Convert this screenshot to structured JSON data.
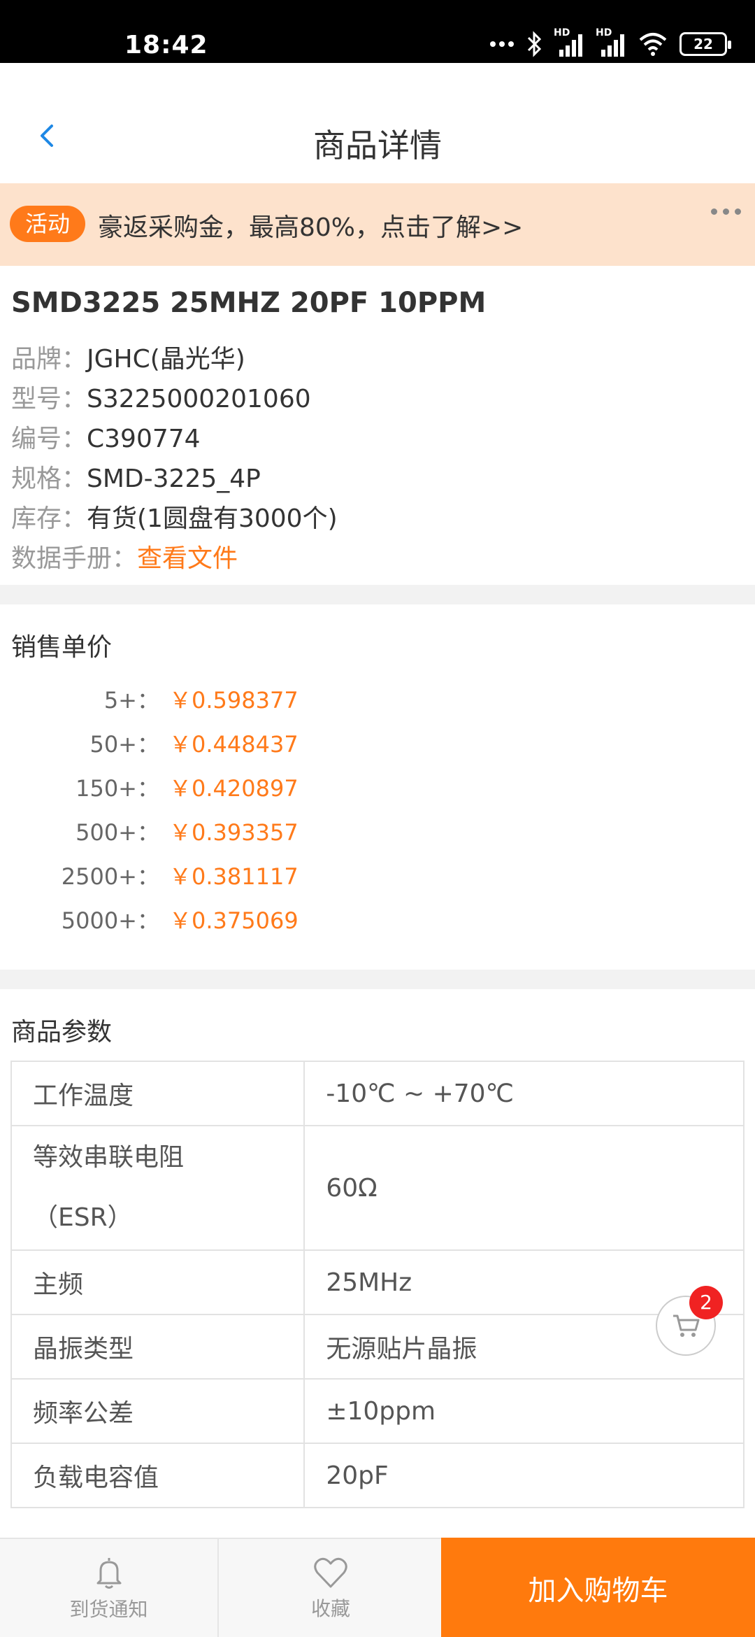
{
  "status_bar": {
    "time": "18:42",
    "battery": "22",
    "network_label": "HD"
  },
  "header": {
    "title": "商品详情",
    "back_icon": "chevron-left-icon"
  },
  "banner": {
    "badge": "活动",
    "text": "豪返采购金，最高80%，点击了解>>"
  },
  "product": {
    "name": "SMD3225 25MHZ 20PF 10PPM",
    "brand_label": "品牌：",
    "brand": "JGHC(晶光华)",
    "model_label": "型号：",
    "model": "S3225000201060",
    "code_label": "编号：",
    "code": "C390774",
    "package_label": "规格：",
    "package": "SMD-3225_4P",
    "stock_label": "库存：",
    "stock": "有货(1圆盘有3000个)",
    "datasheet_label": "数据手册：",
    "datasheet_link": "查看文件"
  },
  "pricing": {
    "title": "销售单价",
    "tiers": [
      {
        "qty": "5+：",
        "price": "￥0.598377"
      },
      {
        "qty": "50+：",
        "price": "￥0.448437"
      },
      {
        "qty": "150+：",
        "price": "￥0.420897"
      },
      {
        "qty": "500+：",
        "price": "￥0.393357"
      },
      {
        "qty": "2500+：",
        "price": "￥0.381117"
      },
      {
        "qty": "5000+：",
        "price": "￥0.375069"
      }
    ]
  },
  "params": {
    "title": "商品参数",
    "rows": [
      {
        "key": "工作温度",
        "value": "-10℃ ~ +70℃"
      },
      {
        "key": "等效串联电阻",
        "key2": "（ESR）",
        "value": "60Ω"
      },
      {
        "key": "主频",
        "value": "25MHz"
      },
      {
        "key": "晶振类型",
        "value": "无源贴片晶振"
      },
      {
        "key": "频率公差",
        "value": "±10ppm"
      },
      {
        "key": "负载电容值",
        "value": "20pF"
      }
    ]
  },
  "float_cart": {
    "count": "2"
  },
  "bottom_bar": {
    "notify_label": "到货通知",
    "favorite_label": "收藏",
    "add_to_cart_label": "加入购物车"
  },
  "colors": {
    "accent": "#ff7a1a",
    "banner_bg": "#fde2cc",
    "badge_red": "#f02222"
  }
}
